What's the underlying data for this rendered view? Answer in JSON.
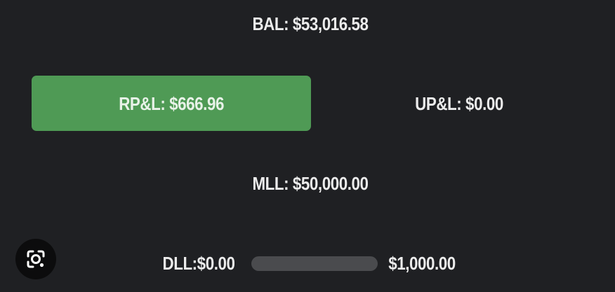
{
  "balance": {
    "text": "BAL: $53,016.58"
  },
  "realized_pnl": {
    "text": "RP&L: $666.96",
    "color": "#4f9a55"
  },
  "unrealized_pnl": {
    "text": "UP&L: $0.00"
  },
  "max_loss_limit": {
    "text": "MLL: $50,000.00"
  },
  "daily_loss_limit": {
    "label": "DLL:$0.00",
    "max": "$1,000.00",
    "progress": 0.0
  },
  "icons": {
    "lens": "lens-search-icon"
  },
  "colors": {
    "background": "#1f2023",
    "text": "#ececec",
    "track": "#4a4b4e"
  }
}
